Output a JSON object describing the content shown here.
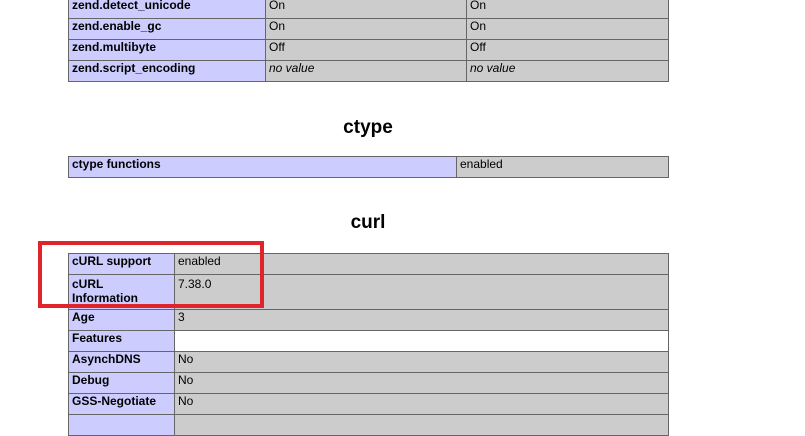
{
  "zend": {
    "rows": [
      {
        "directive": "zend.detect_unicode",
        "local": "On",
        "master": "On"
      },
      {
        "directive": "zend.enable_gc",
        "local": "On",
        "master": "On"
      },
      {
        "directive": "zend.multibyte",
        "local": "Off",
        "master": "Off"
      },
      {
        "directive": "zend.script_encoding",
        "local": "no value",
        "master": "no value"
      }
    ]
  },
  "ctype": {
    "title": "ctype",
    "row": {
      "name": "ctype functions",
      "value": "enabled"
    }
  },
  "curl": {
    "title": "curl",
    "rows": [
      {
        "name": "cURL support",
        "value": "enabled"
      },
      {
        "name": "cURL Information",
        "value": "7.38.0"
      },
      {
        "name": "Age",
        "value": "3"
      },
      {
        "name": "Features",
        "value": ""
      },
      {
        "name": "AsynchDNS",
        "value": "No"
      },
      {
        "name": "Debug",
        "value": "No"
      },
      {
        "name": "GSS-Negotiate",
        "value": "No"
      }
    ]
  },
  "annotation": {
    "highlight_color": "#e0242b"
  }
}
